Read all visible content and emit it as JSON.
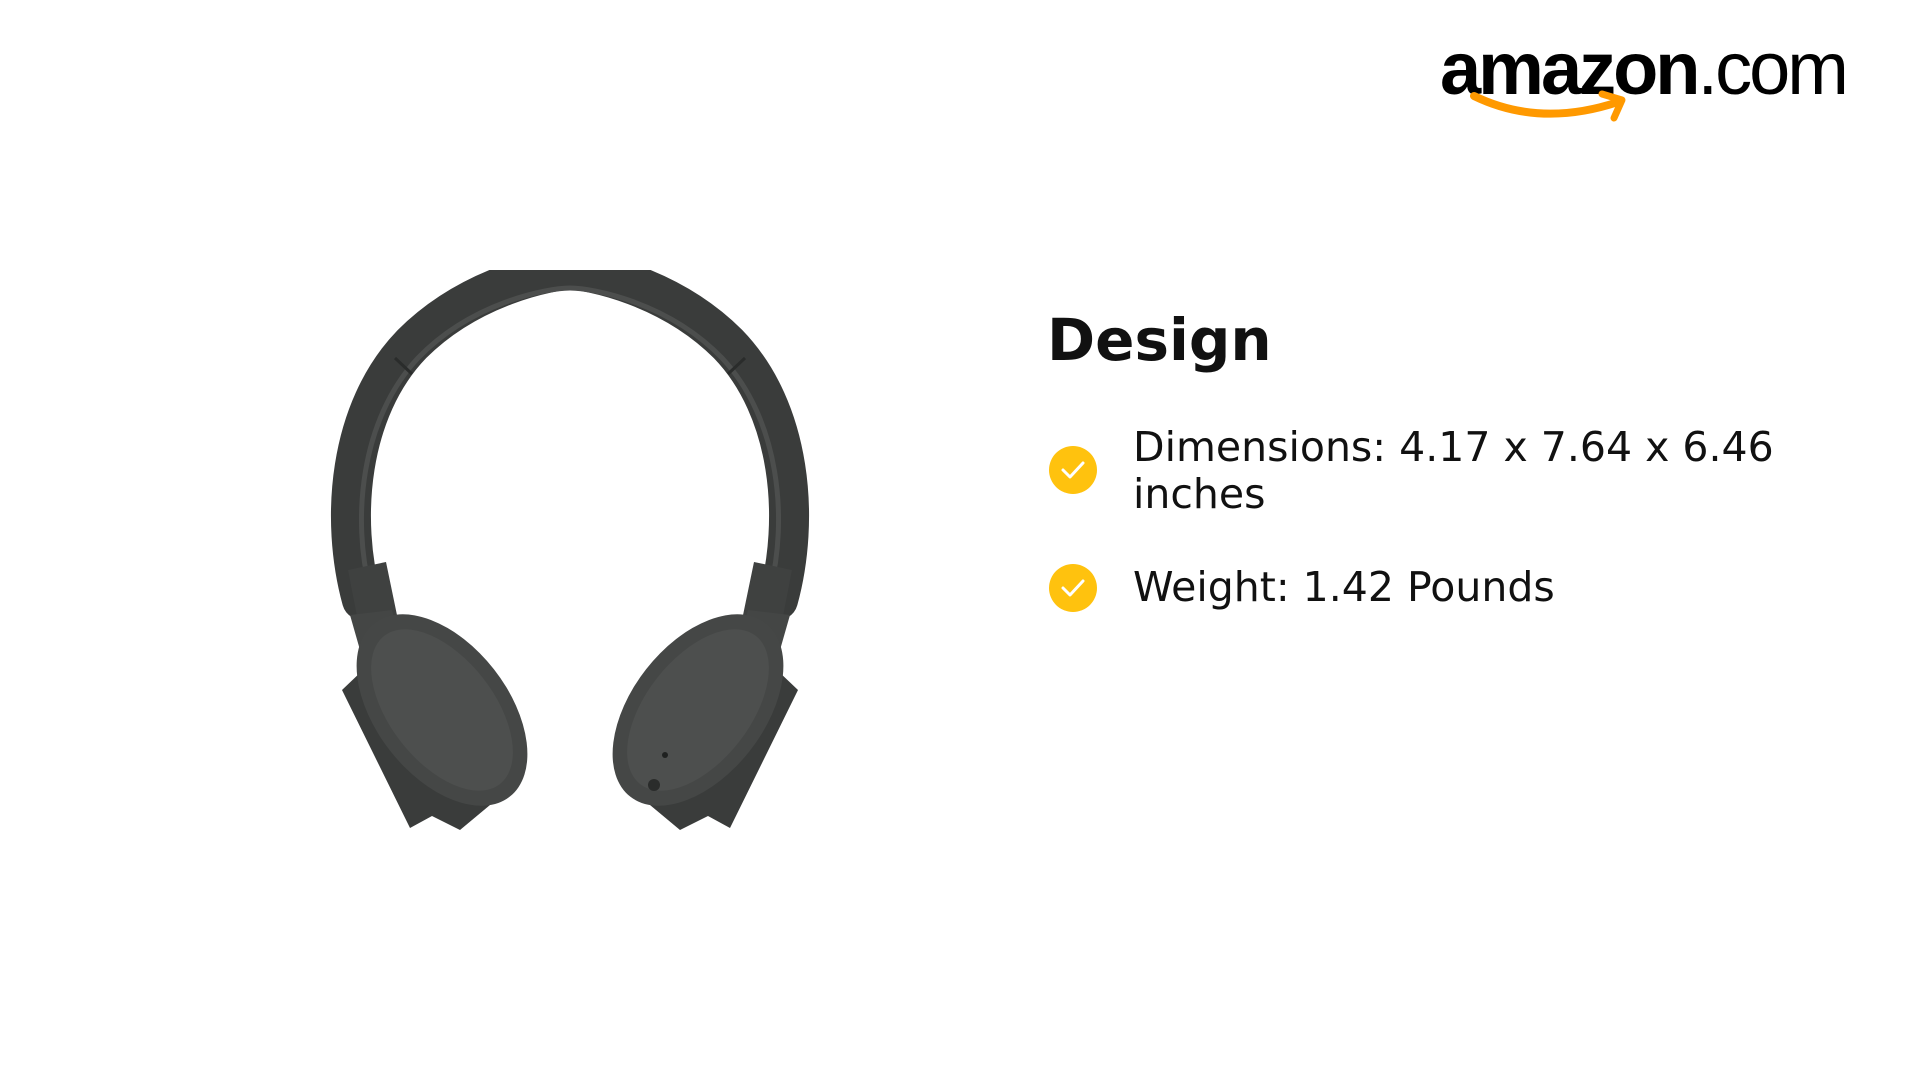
{
  "brand": {
    "logo_main": "amazon",
    "logo_tld": ".com",
    "smile_color": "#FF9900"
  },
  "product_image": {
    "icon": "headphones-image",
    "color": "#3b3d3c"
  },
  "section": {
    "title": "Design",
    "features": [
      {
        "icon": "check-circle-icon",
        "text": "Dimensions: 4.17 x 7.64 x 6.46 inches"
      },
      {
        "icon": "check-circle-icon",
        "text": "Weight: 1.42 Pounds"
      }
    ]
  },
  "colors": {
    "accent": "#FFC20E",
    "text": "#111111",
    "background": "#FFFFFF"
  }
}
